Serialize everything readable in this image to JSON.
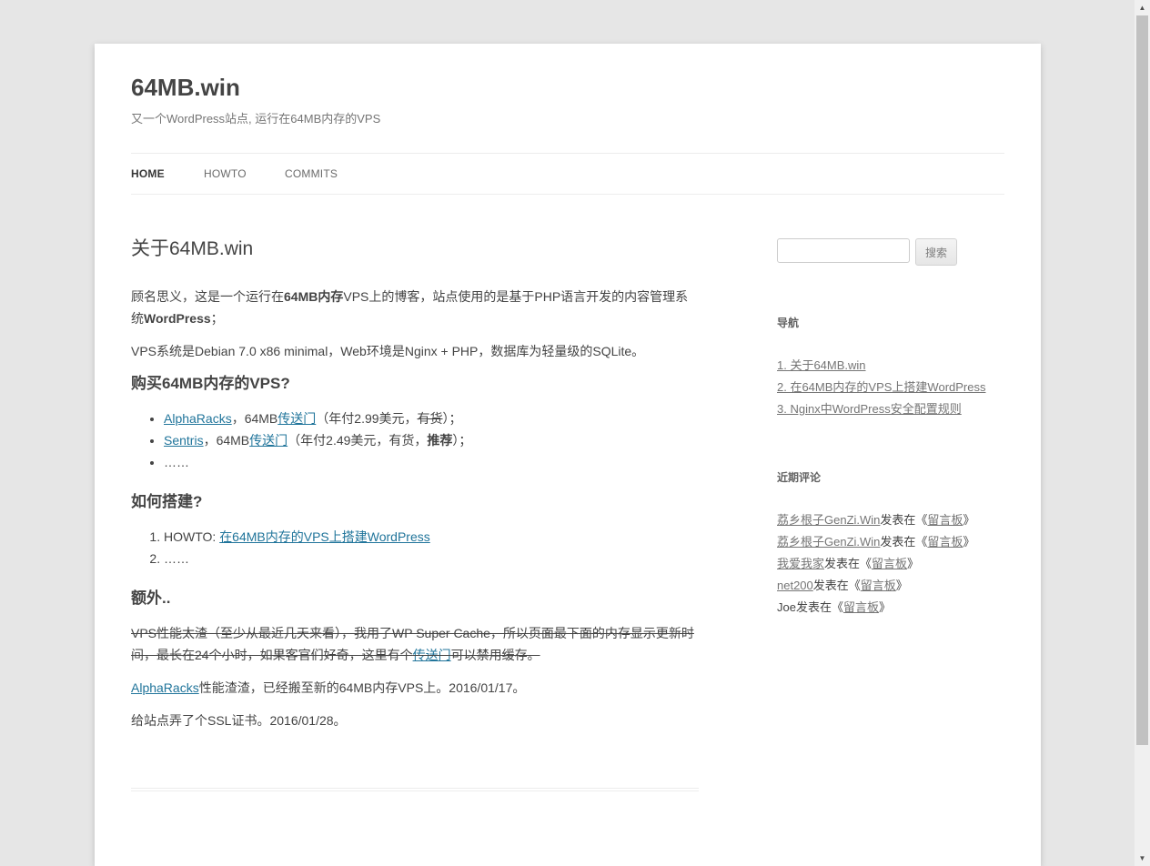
{
  "site": {
    "title": "64MB.win",
    "description": "又一个WordPress站点, 运行在64MB内存的VPS"
  },
  "nav": {
    "items": [
      {
        "label": "HOME",
        "current": true
      },
      {
        "label": "HOWTO",
        "current": false
      },
      {
        "label": "COMMITS",
        "current": false
      }
    ]
  },
  "article": {
    "title": "关于64MB.win",
    "intro": {
      "part1": "顾名思义，这是一个运行在",
      "bold1": "64MB内存",
      "part2": "VPS上的博客，站点使用的是基于PHP语言开发的内容管理系统",
      "bold2": "WordPress",
      "part3": "；"
    },
    "env": "VPS系统是Debian 7.0 x86 minimal，Web环境是Nginx + PHP，数据库为轻量级的SQLite。",
    "buy_heading": "购买64MB内存的VPS?",
    "buy_list": [
      {
        "name": "AlphaRacks",
        "sep": "，64MB",
        "link": "传送门",
        "note_pre": "（年付2.99美元，",
        "note_del": "有货",
        "note_strong": "",
        "note_post": "）；"
      },
      {
        "name": "Sentris",
        "sep": "，64MB",
        "link": "传送门",
        "note_pre": "（年付2.49美元，有货，",
        "note_del": "",
        "note_strong": "推荐",
        "note_post": "）；"
      },
      {
        "ellipsis": "……"
      }
    ],
    "build_heading": "如何搭建?",
    "build_list": [
      {
        "prefix": "HOWTO: ",
        "link": "在64MB内存的VPS上搭建WordPress"
      },
      {
        "ellipsis": "……"
      }
    ],
    "extra_heading": "额外..",
    "extra_del": {
      "text": "VPS性能太渣（至少从最近几天来看），我用了WP Super Cache，所以页面最下面的内存显示更新时间，最长在24个小时，如果客官们好奇，这里有个",
      "link": "传送门",
      "tail": "可以禁用缓存。"
    },
    "extra_moved": {
      "link": "AlphaRacks",
      "text": "性能渣渣，已经搬至新的64MB内存VPS上。2016/01/17。"
    },
    "extra_ssl": "给站点弄了个SSL证书。2016/01/28。"
  },
  "sidebar": {
    "search_button": "搜索",
    "search_placeholder": "",
    "nav_widget_title": "导航",
    "nav_links": [
      "1. 关于64MB.win",
      "2. 在64MB内存的VPS上搭建WordPress",
      "3. Nginx中WordPress安全配置规则"
    ],
    "comments_title": "近期评论",
    "comments": [
      {
        "author": "荔乡根子GenZi.Win",
        "mid": "发表在《",
        "post": "留言板",
        "end": "》",
        "author_linked": true
      },
      {
        "author": "荔乡根子GenZi.Win",
        "mid": "发表在《",
        "post": "留言板",
        "end": "》",
        "author_linked": true
      },
      {
        "author": "我爱我家",
        "mid": "发表在《",
        "post": "留言板",
        "end": "》",
        "author_linked": true
      },
      {
        "author": "net200",
        "mid": "发表在《",
        "post": "留言板",
        "end": "》",
        "author_linked": true
      },
      {
        "author": "Joe",
        "mid": "发表在《",
        "post": "留言板",
        "end": "》",
        "author_linked": false
      }
    ]
  },
  "colors": {
    "link": "#21759b",
    "background": "#e6e6e6",
    "page": "#ffffff",
    "text": "#444444"
  },
  "icons": {
    "scroll_up": "triangle-up-icon",
    "scroll_down": "triangle-down-icon"
  }
}
